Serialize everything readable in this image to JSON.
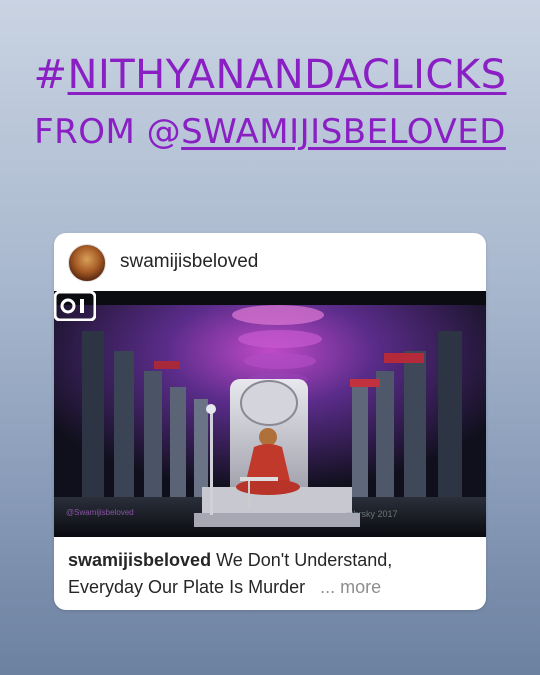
{
  "headline": {
    "hash": "#",
    "tag": "NITHYANANDACLICKS",
    "from_prefix": "FROM @",
    "from_handle": "SWAMIJISBELOVED"
  },
  "post": {
    "username": "swamijisbeloved",
    "caption_user": "swamijisbeloved",
    "caption_text": " We Don't Understand, Everyday Our Plate Is Murder",
    "more_label": "... more",
    "watermark_left": "@Swamijisbeloved",
    "watermark_right": "nthrsky 2017",
    "media_icon": "igtv-icon"
  },
  "colors": {
    "headline": "#8a1fc4",
    "card": "#ffffff"
  }
}
